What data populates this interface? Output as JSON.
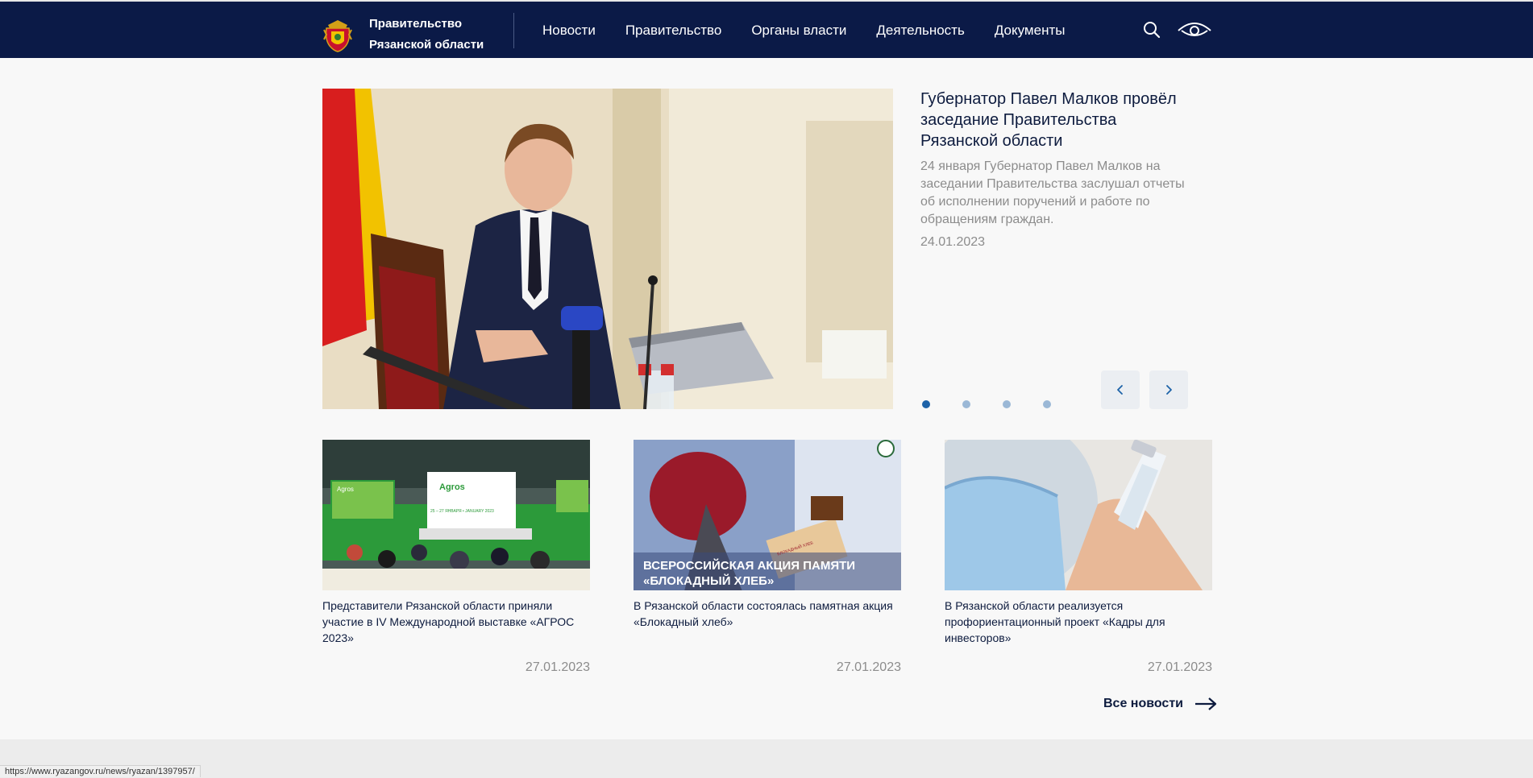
{
  "header": {
    "logo_line1": "Правительство",
    "logo_line2": "Рязанской области",
    "nav": [
      "Новости",
      "Правительство",
      "Органы власти",
      "Деятельность",
      "Документы"
    ],
    "icons": {
      "search": "search-icon",
      "accessibility": "eye-icon"
    }
  },
  "hero": {
    "title": "Губернатор Павел Малков провёл заседание Правительства Рязанской области",
    "description": "24 января Губернатор Павел Малков на заседании Правительства заслушал отчеты об исполнении поручений и работе по обращениям граждан.",
    "date": "24.01.2023",
    "slides_count": 4,
    "active_slide": 1
  },
  "cards": [
    {
      "title": "Представители Рязанской области приняли участие в IV Международной выставке «АГРОС 2023»",
      "date": "27.01.2023",
      "image_texts": [
        "Agros",
        "Agros",
        "25 – 27 ЯНВАРЯ • JANUARY 2023"
      ]
    },
    {
      "title": "В Рязанской области состоялась памятная акция «Блокадный хлеб»",
      "date": "27.01.2023",
      "image_texts": [
        "ВСЕРОССИЙСКАЯ АКЦИЯ ПАМЯТИ",
        "«БЛОКАДНЫЙ ХЛЕБ»",
        "БЛОКАДНЫЙ ХЛЕБ"
      ]
    },
    {
      "title": "В Рязанской области реализуется профориентационный проект «Кадры для инвесторов»",
      "date": "27.01.2023",
      "image_texts": []
    }
  ],
  "all_news_label": "Все новости",
  "status_url": "https://www.ryazangov.ru/news/ryazan/1397957/",
  "colors": {
    "header_bg": "#0b1a47",
    "page_bg": "#f8f8f8",
    "text_dark": "#0d1b3e",
    "text_muted": "#8c8c8c",
    "dot_active": "#1e63a8",
    "dot_inactive": "#9bb8d6"
  }
}
